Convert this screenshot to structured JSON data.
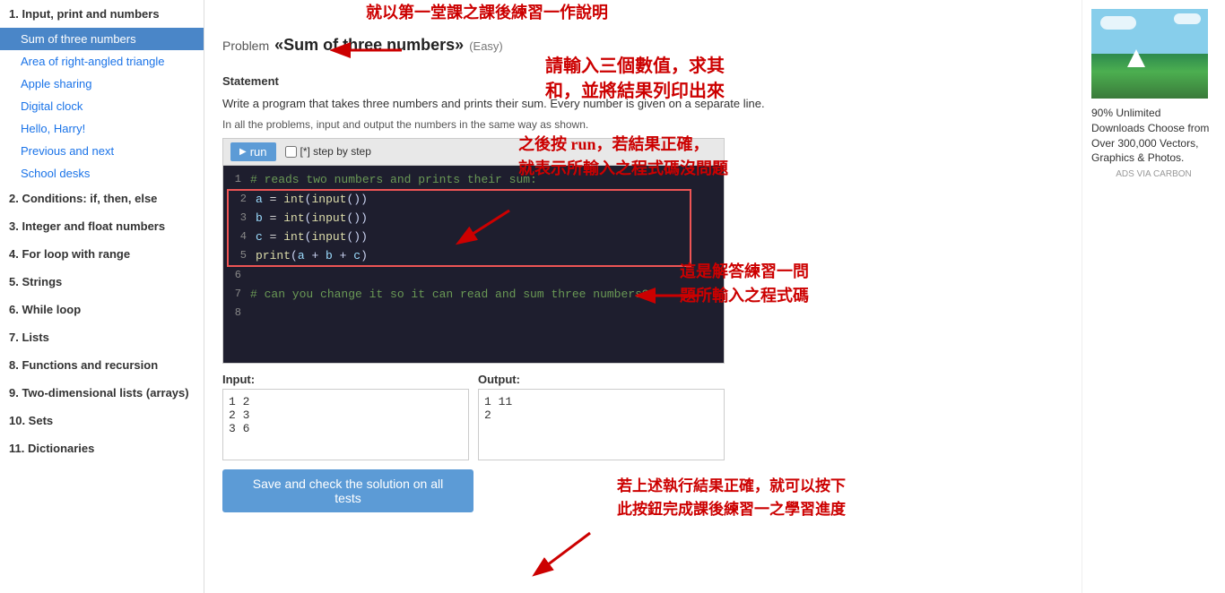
{
  "sidebar": {
    "sections": [
      {
        "id": "section-1",
        "label": "1. Input, print and numbers",
        "items": [
          {
            "id": "sum-of-three",
            "label": "Sum of three numbers",
            "active": true
          },
          {
            "id": "area-right-triangle",
            "label": "Area of right-angled triangle",
            "active": false
          },
          {
            "id": "apple-sharing",
            "label": "Apple sharing",
            "active": false
          },
          {
            "id": "digital-clock",
            "label": "Digital clock",
            "active": false
          },
          {
            "id": "hello-harry",
            "label": "Hello, Harry!",
            "active": false
          },
          {
            "id": "previous-and-next",
            "label": "Previous and next",
            "active": false
          },
          {
            "id": "school-desks",
            "label": "School desks",
            "active": false
          }
        ]
      },
      {
        "id": "section-2",
        "label": "2. Conditions: if, then, else",
        "items": []
      },
      {
        "id": "section-3",
        "label": "3. Integer and float numbers",
        "items": []
      },
      {
        "id": "section-4",
        "label": "4. For loop with range",
        "items": []
      },
      {
        "id": "section-5",
        "label": "5. Strings",
        "items": []
      },
      {
        "id": "section-6",
        "label": "6. While loop",
        "items": []
      },
      {
        "id": "section-7",
        "label": "7. Lists",
        "items": []
      },
      {
        "id": "section-8",
        "label": "8. Functions and recursion",
        "items": []
      },
      {
        "id": "section-9",
        "label": "9. Two-dimensional lists (arrays)",
        "items": []
      },
      {
        "id": "section-10",
        "label": "10. Sets",
        "items": []
      },
      {
        "id": "section-11",
        "label": "11. Dictionaries",
        "items": []
      }
    ]
  },
  "problem": {
    "prefix": "Problem",
    "title": "«Sum of three numbers»",
    "difficulty": "(Easy)",
    "statement_label": "Statement",
    "statement_text": "Write a program that takes three numbers and prints their sum. Every number is given on a separate line.",
    "in_all": "In all the problems, input and output the numbers in the same way as shown.",
    "run_btn": "run",
    "step_by_step": "[*] step by step",
    "code_lines": [
      {
        "num": "1",
        "text": "# reads two numbers and prints their sum:"
      },
      {
        "num": "2",
        "text": "a = int(input())"
      },
      {
        "num": "3",
        "text": "b = int(input())"
      },
      {
        "num": "4",
        "text": "c = int(input())"
      },
      {
        "num": "5",
        "text": "print(a + b + c)"
      },
      {
        "num": "6",
        "text": ""
      },
      {
        "num": "7",
        "text": "# can you change it so it can read and sum three numbers?"
      },
      {
        "num": "8",
        "text": ""
      }
    ],
    "input_label": "Input:",
    "input_values": [
      "1  2",
      "2  3",
      "3  6"
    ],
    "output_label": "Output:",
    "output_values": [
      "1  11",
      "2"
    ],
    "save_btn": "Save and check the solution on all tests"
  },
  "annotations": {
    "title_note": "就以第一堂課之課後練習一作說明",
    "statement_note1": "請輸入三個數值，求其",
    "statement_note2": "和，並將結果列印出來",
    "run_note1": "之後按 run，若結果正確，",
    "run_note2": "就表示所輸入之程式碼沒問題",
    "code_note1": "這是解答練習一問",
    "code_note2": "題所輸入之程式碼",
    "save_note1": "若上述執行結果正確，就可以按下",
    "save_note2": "此按鈕完成課後練習一之學習進度"
  },
  "ad": {
    "text": "90% Unlimited Downloads Choose from Over 300,000 Vectors, Graphics & Photos.",
    "footer": "ADS VIA CARBON"
  }
}
